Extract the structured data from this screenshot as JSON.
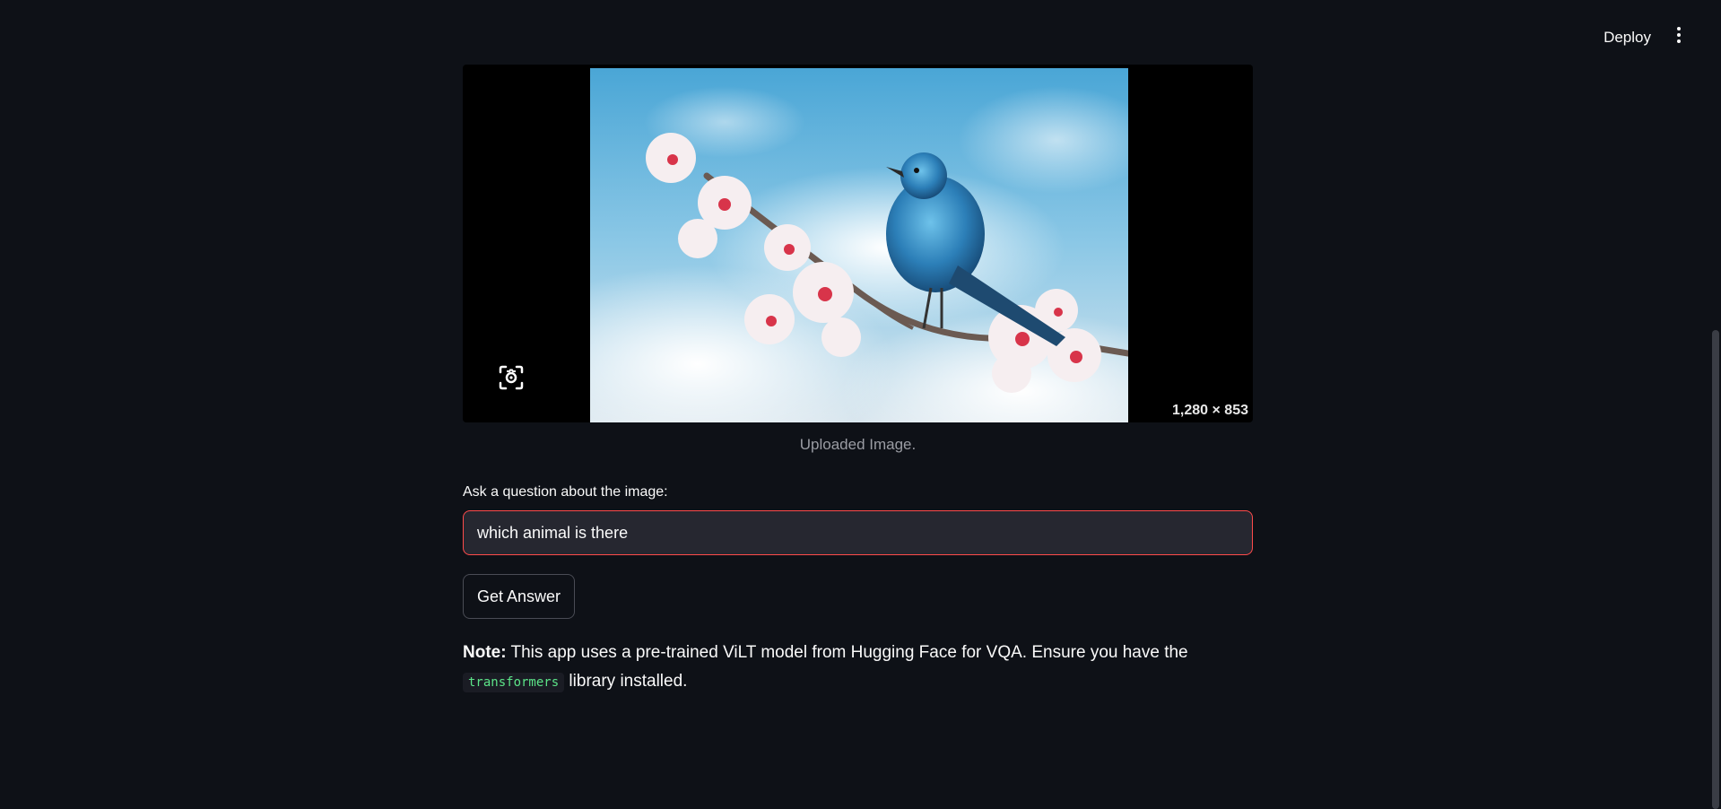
{
  "header": {
    "deploy_label": "Deploy",
    "menu_icon": "more-vertical-icon"
  },
  "image": {
    "dimensions_label": "1,280 × 853",
    "caption": "Uploaded Image.",
    "lens_icon": "google-lens-icon"
  },
  "question": {
    "label": "Ask a question about the image:",
    "value": "which animal is there"
  },
  "button": {
    "label": "Get Answer"
  },
  "note": {
    "bold": "Note:",
    "text_before": " This app uses a pre-trained ViLT model from Hugging Face for VQA. Ensure you have the",
    "code": "transformers",
    "text_after": " library installed."
  },
  "colors": {
    "background": "#0e1117",
    "input_bg": "#262730",
    "focus_border": "#ff4b4b",
    "code_green": "#5ce488"
  }
}
